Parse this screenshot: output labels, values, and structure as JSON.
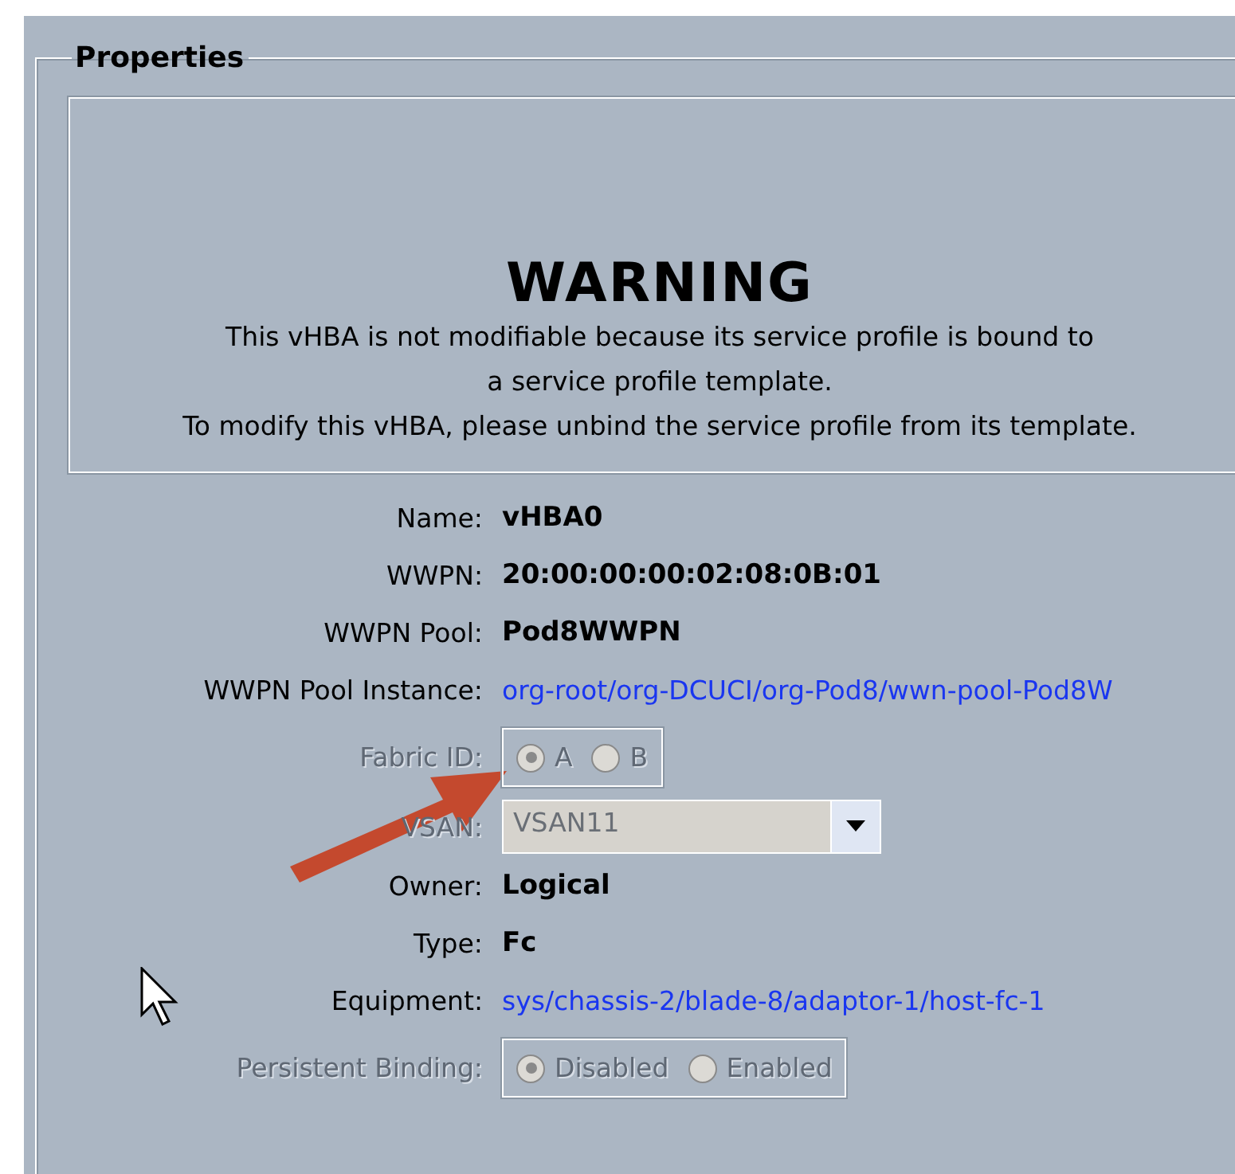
{
  "panel": {
    "title": "Properties"
  },
  "warning": {
    "heading": "WARNING",
    "lines": [
      "This vHBA is not modifiable because its service profile is bound to",
      "a service profile template.",
      "To modify this vHBA, please unbind the service profile from its template."
    ]
  },
  "fields": [
    {
      "kind": "text",
      "label": "Name:",
      "value": "vHBA0",
      "disabled": false
    },
    {
      "kind": "text",
      "label": "WWPN:",
      "value": "20:00:00:00:02:08:0B:01",
      "disabled": false
    },
    {
      "kind": "text",
      "label": "WWPN Pool:",
      "value": "Pod8WWPN",
      "disabled": false
    },
    {
      "kind": "link",
      "label": "WWPN Pool Instance:",
      "value": "org-root/org-DCUCI/org-Pod8/wwn-pool-Pod8W",
      "disabled": false
    },
    {
      "kind": "radio",
      "label": "Fabric ID:",
      "disabled": true,
      "options": [
        {
          "label": "A",
          "selected": true
        },
        {
          "label": "B",
          "selected": false
        }
      ]
    },
    {
      "kind": "dropdown",
      "label": "VSAN:",
      "value": "VSAN11",
      "disabled": true
    },
    {
      "kind": "text",
      "label": "Owner:",
      "value": "Logical",
      "disabled": false
    },
    {
      "kind": "text",
      "label": "Type:",
      "value": "Fc",
      "disabled": false
    },
    {
      "kind": "link",
      "label": "Equipment:",
      "value": "sys/chassis-2/blade-8/adaptor-1/host-fc-1",
      "disabled": false
    },
    {
      "kind": "radio",
      "label": "Persistent Binding:",
      "disabled": true,
      "options": [
        {
          "label": "Disabled",
          "selected": true
        },
        {
          "label": "Enabled",
          "selected": false
        }
      ]
    }
  ]
}
